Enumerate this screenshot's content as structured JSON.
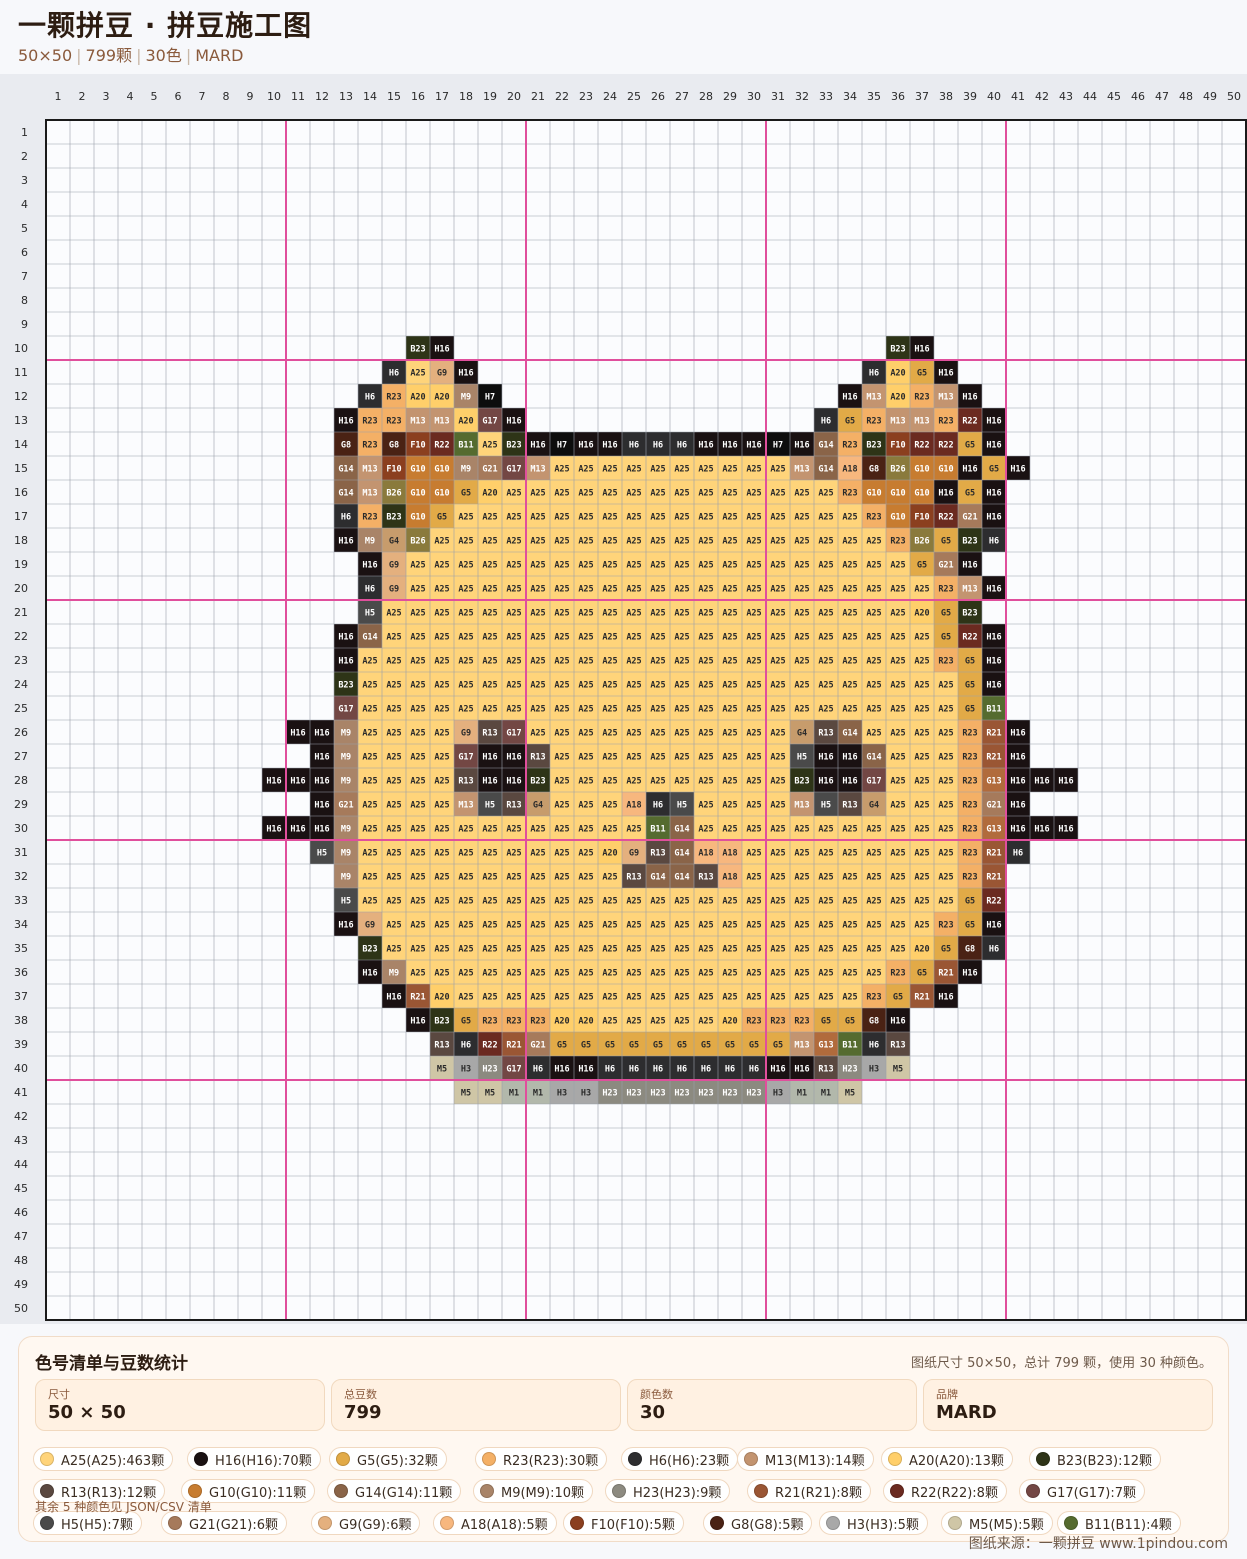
{
  "header": {
    "title": "一颗拼豆 · 拼豆施工图",
    "size": "50×50",
    "count": "799颗",
    "colors": "30色",
    "brand": "MARD"
  },
  "grid": {
    "cols": 50,
    "rows": 50,
    "section_every": 10,
    "section_line_color": "#e04f9c",
    "pattern_rows": {
      "10": [
        [
          16,
          "B23"
        ],
        [
          17,
          "H16"
        ],
        [
          36,
          "B23"
        ],
        [
          37,
          "H16"
        ]
      ],
      "11": [
        [
          15,
          "H6"
        ],
        [
          16,
          "A25"
        ],
        [
          17,
          "G9"
        ],
        [
          18,
          "H16"
        ],
        [
          35,
          "H6"
        ],
        [
          36,
          "A20"
        ],
        [
          37,
          "G5"
        ],
        [
          38,
          "H16"
        ]
      ],
      "12": [
        [
          14,
          "H6"
        ],
        [
          15,
          "R23"
        ],
        [
          16,
          "A20"
        ],
        [
          17,
          "A20"
        ],
        [
          18,
          "M9"
        ],
        [
          19,
          "H7"
        ],
        [
          34,
          "H16"
        ],
        [
          35,
          "M13"
        ],
        [
          36,
          "A20"
        ],
        [
          37,
          "R23"
        ],
        [
          38,
          "M13"
        ],
        [
          39,
          "H16"
        ]
      ],
      "13": [
        [
          13,
          "H16"
        ],
        [
          14,
          "R23"
        ],
        [
          15,
          "R23"
        ],
        [
          16,
          "M13"
        ],
        [
          17,
          "M13"
        ],
        [
          18,
          "A20"
        ],
        [
          19,
          "G17"
        ],
        [
          20,
          "H16"
        ],
        [
          33,
          "H6"
        ],
        [
          34,
          "G5"
        ],
        [
          35,
          "R23"
        ],
        [
          36,
          "M13"
        ],
        [
          37,
          "M13"
        ],
        [
          38,
          "R23"
        ],
        [
          39,
          "R22"
        ],
        [
          40,
          "H16"
        ]
      ],
      "14": [
        "13:G8",
        "14:R23",
        "15:G8",
        "16:F10",
        "17:R22",
        "18:B11",
        "19:A25",
        "20:B23",
        "21:H16",
        "22:H7",
        "23:H16",
        "24:H16",
        "25:H6",
        "26:H6",
        "27:H6",
        "28:H16",
        "29:H16",
        "30:H16",
        "31:H7",
        "32:H16",
        "33:G14",
        "34:R23",
        "35:B23",
        "36:F10",
        "37:R22",
        "38:R22",
        "39:G5",
        "40:H16"
      ],
      "15": [
        "13:G14",
        "14:M13",
        "15:F10",
        "16:G10",
        "17:G10",
        "18:M9",
        "19:G21",
        "20:G17",
        "21:M13",
        "22-31:A25",
        "32:M13",
        "33:G14",
        "34:A18",
        "35:G8",
        "36:B26",
        "37:G10",
        "38:G10",
        "39:H16",
        "40:G5",
        "41:H16"
      ],
      "16": [
        "13:G14",
        "14:M13",
        "15:B26",
        "16:G10",
        "17:G10",
        "18:G5",
        "19:A20",
        "20-33:A25",
        "34:R23",
        "35:G10",
        "36:G10",
        "37:G10",
        "38:H16",
        "39:G5",
        "40:H16"
      ],
      "17": [
        "13:H6",
        "14:R23",
        "15:B23",
        "16:G10",
        "17:G5",
        "18-34:A25",
        "35:R23",
        "36:G10",
        "37:F10",
        "38:R22",
        "39:G21",
        "40:H16"
      ],
      "18": [
        "13:H16",
        "14:M9",
        "15:G4",
        "16:B26",
        "17-35:A25",
        "36:R23",
        "37:B26",
        "38:G5",
        "39:B23",
        "40:H6"
      ],
      "19": [
        "14:H16",
        "15:G9",
        "16-36:A25",
        "37:G5",
        "38:G21",
        "39:H16"
      ],
      "20": [
        "14:H6",
        "15:G9",
        "16-37:A25",
        "38:R23",
        "39:M13",
        "40:H16"
      ],
      "21": [
        "14:H5",
        "15-36:A25",
        "37:A20",
        "38:G5",
        "39:B23"
      ],
      "22": [
        "13:H16",
        "14:G14",
        "15-37:A25",
        "38:G5",
        "39:R22",
        "40:H16"
      ],
      "23": [
        "13:H16",
        "14-37:A25",
        "38:R23",
        "39:G5",
        "40:H16"
      ],
      "24": [
        "13:B23",
        "14-38:A25",
        "39:G5",
        "40:H16"
      ],
      "25": [
        "13:G17",
        "14-38:A25",
        "39:G5",
        "40:B11"
      ],
      "26": [
        "11:H16",
        "12:H16",
        "13:M9",
        "14-17:A25",
        "18:G9",
        "19:R13",
        "20:G17",
        "21-31:A25",
        "32:G4",
        "33:R13",
        "34:G14",
        "35-37:A25",
        "38:A25",
        "39:R23",
        "40:R21",
        "41:H16"
      ],
      "27": [
        "12:H16",
        "13:M9",
        "14-17:A25",
        "18:G17",
        "19:H16",
        "20:H16",
        "21:R13",
        "22-31:A25",
        "32:H5",
        "33:H16",
        "34:H16",
        "35:G14",
        "36-38:A25",
        "39:R23",
        "40:R21",
        "41:H16"
      ],
      "28": [
        "10:H16",
        "11:H16",
        "12:H16",
        "13:M9",
        "14-17:A25",
        "18:R13",
        "19:H16",
        "20:H16",
        "21:B23",
        "22-31:A25",
        "32:B23",
        "33:H16",
        "34:H16",
        "35:G17",
        "36-38:A25",
        "39:R23",
        "40:G13",
        "41:H16",
        "42:H16",
        "43:H16"
      ],
      "29": [
        "12:H16",
        "13:G21",
        "14-17:A25",
        "18:M13",
        "19:H5",
        "20:R13",
        "21:G4",
        "22-24:A25",
        "25:A18",
        "26:H6",
        "27:H5",
        "28-31:A25",
        "32:M13",
        "33:H5",
        "34:R13",
        "35:G4",
        "36-38:A25",
        "39:R23",
        "40:G21",
        "41:H16"
      ],
      "30": [
        "10:H16",
        "11:H16",
        "12:H16",
        "13:M9",
        "14-25:A25",
        "26:B11",
        "27:G14",
        "28-38:A25",
        "39:R23",
        "40:G13",
        "41:H16",
        "42:H16",
        "43:H16"
      ],
      "31": [
        "12:H5",
        "13:M9",
        "14-23:A25",
        "24:A20",
        "25:G9",
        "26:R13",
        "27:G14",
        "28:A18",
        "29:A18",
        "30-38:A25",
        "39:R23",
        "40:R21",
        "41:H6"
      ],
      "32": [
        "13:M9",
        "14-24:A25",
        "25:R13",
        "26:G14",
        "27:G14",
        "28:R13",
        "29:A18",
        "30-38:A25",
        "39:R23",
        "40:R21"
      ],
      "33": [
        "13:H5",
        "14-38:A25",
        "39:G5",
        "40:R22"
      ],
      "34": [
        "13:H16",
        "14:G9",
        "15-37:A25",
        "38:R23",
        "39:G5",
        "40:H16"
      ],
      "35": [
        "14:B23",
        "15-36:A25",
        "37:A20",
        "38:G5",
        "39:G8",
        "40:H6"
      ],
      "36": [
        "14:H16",
        "15:M9",
        "16-35:A25",
        "36:R23",
        "37:G5",
        "38:R21",
        "39:H16"
      ],
      "37": [
        "15:H16",
        "16:R21",
        "17:A20",
        "18-34:A25",
        "35:R23",
        "36:G5",
        "37:R21",
        "38:H16"
      ],
      "38": [
        "16:H16",
        "17:B23",
        "18:G5",
        "19:R23",
        "20:R23",
        "21:R23",
        "22:A20",
        "23:A20",
        "24-28:A25",
        "29:A20",
        "30:R23",
        "31:R23",
        "32:R23",
        "33:G5",
        "34:G5",
        "35:G8",
        "36:H16"
      ],
      "39": [
        "17:R13",
        "18:H6",
        "19:R22",
        "20:R21",
        "21:G21",
        "22-31:G5",
        "32:M13",
        "33:G13",
        "34:B11",
        "35:H6",
        "36:R13"
      ],
      "40": [
        "17:M5",
        "18:H3",
        "19:H23",
        "20:G17",
        "21:H6",
        "22:H16",
        "23:H16",
        "24-30:H6",
        "31:H16",
        "32:H16",
        "33:R13",
        "34:H23",
        "35:H3",
        "36:M5"
      ],
      "41": [
        "18:M5",
        "19:M5",
        "20:M1",
        "21:M1",
        "22:H3",
        "23:H3",
        "24-30:H23",
        "31:H3",
        "32:M1",
        "33:M1",
        "34:M5"
      ]
    },
    "palette": {
      "A25": "#ffd47a",
      "A20": "#ffcf6a",
      "A18": "#f7b77e",
      "H16": "#1a1112",
      "H7": "#0d0d0d",
      "H6": "#2d2d2f",
      "H5": "#4a4a4a",
      "H3": "#a8a8a8",
      "H23": "#8c8a80",
      "G5": "#e2aa47",
      "G9": "#e4b07e",
      "G4": "#c79c6c",
      "G8": "#4a2214",
      "G10": "#c77c30",
      "G13": "#b16b3c",
      "G14": "#8a6448",
      "G17": "#734744",
      "G21": "#a67a5b",
      "R23": "#f4b066",
      "R22": "#6b2a20",
      "R21": "#9a5634",
      "R13": "#5a4840",
      "M13": "#c39470",
      "M9": "#a98468",
      "M5": "#cfc6a6",
      "M1": "#b2b8ab",
      "B23": "#2e3417",
      "B11": "#556b2f",
      "B26": "#8a7a3c",
      "F10": "#8b3f1f"
    },
    "dark_labels": [
      "H16",
      "H7",
      "H6",
      "H5",
      "B23",
      "G8",
      "R22",
      "R13",
      "G17",
      "F10",
      "B11",
      "H23",
      "G14",
      "R21",
      "G21",
      "G13",
      "B26",
      "M9",
      "M13",
      "G10"
    ]
  },
  "footer": {
    "title": "色号清单与豆数统计",
    "summary": "图纸尺寸 50×50，总计 799 颗，使用 30 种颜色。",
    "stats": [
      {
        "label": "尺寸",
        "value": "50 × 50"
      },
      {
        "label": "总豆数",
        "value": "799"
      },
      {
        "label": "颜色数",
        "value": "30"
      },
      {
        "label": "品牌",
        "value": "MARD"
      }
    ],
    "chips": [
      {
        "text": "A25(A25):463颗",
        "color": "#ffd47a"
      },
      {
        "text": "H16(H16):70颗",
        "color": "#1a1112"
      },
      {
        "text": "G5(G5):32颗",
        "color": "#e2aa47"
      },
      {
        "text": "R23(R23):30颗",
        "color": "#f4b066"
      },
      {
        "text": "H6(H6):23颗",
        "color": "#2d2d2f"
      },
      {
        "text": "M13(M13):14颗",
        "color": "#c39470"
      },
      {
        "text": "A20(A20):13颗",
        "color": "#ffcf6a"
      },
      {
        "text": "B23(B23):12颗",
        "color": "#2e3417"
      },
      {
        "text": "R13(R13):12颗",
        "color": "#5a4840"
      },
      {
        "text": "G10(G10):11颗",
        "color": "#c77c30"
      },
      {
        "text": "G14(G14):11颗",
        "color": "#8a6448"
      },
      {
        "text": "M9(M9):10颗",
        "color": "#a98468"
      },
      {
        "text": "H23(H23):9颗",
        "color": "#8c8a80"
      },
      {
        "text": "R21(R21):8颗",
        "color": "#9a5634"
      },
      {
        "text": "R22(R22):8颗",
        "color": "#6b2a20"
      },
      {
        "text": "G17(G17):7颗",
        "color": "#734744"
      },
      {
        "text": "H5(H5):7颗",
        "color": "#4a4a4a"
      },
      {
        "text": "G21(G21):6颗",
        "color": "#a67a5b"
      },
      {
        "text": "G9(G9):6颗",
        "color": "#e4b07e"
      },
      {
        "text": "A18(A18):5颗",
        "color": "#f7b77e"
      },
      {
        "text": "F10(F10):5颗",
        "color": "#8b3f1f"
      },
      {
        "text": "G8(G8):5颗",
        "color": "#4a2214"
      },
      {
        "text": "H3(H3):5颗",
        "color": "#a8a8a8"
      },
      {
        "text": "M5(M5):5颗",
        "color": "#cfc6a6"
      },
      {
        "text": "B11(B11):4颗",
        "color": "#556b2f"
      }
    ],
    "rest_note": "其余 5 种颜色见 JSON/CSV 清单",
    "source": "图纸来源：一颗拼豆 www.1pindou.com"
  }
}
